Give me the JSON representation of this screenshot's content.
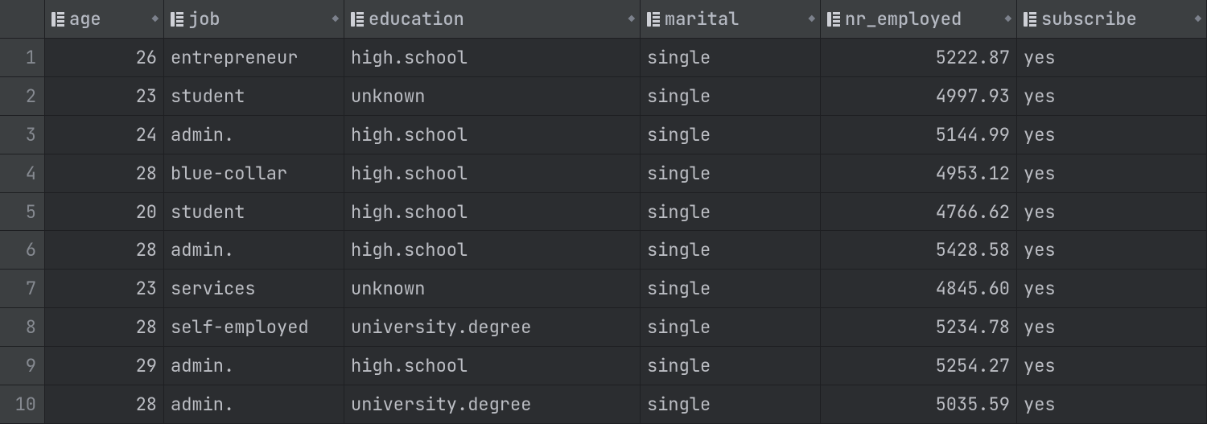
{
  "columns": [
    {
      "name": "age",
      "align": "num"
    },
    {
      "name": "job",
      "align": "txt"
    },
    {
      "name": "education",
      "align": "txt"
    },
    {
      "name": "marital",
      "align": "txt"
    },
    {
      "name": "nr_employed",
      "align": "num"
    },
    {
      "name": "subscribe",
      "align": "txt"
    }
  ],
  "rows": [
    {
      "n": "1",
      "age": "26",
      "job": "entrepreneur",
      "education": "high.school",
      "marital": "single",
      "nr_employed": "5222.87",
      "subscribe": "yes"
    },
    {
      "n": "2",
      "age": "23",
      "job": "student",
      "education": "unknown",
      "marital": "single",
      "nr_employed": "4997.93",
      "subscribe": "yes"
    },
    {
      "n": "3",
      "age": "24",
      "job": "admin.",
      "education": "high.school",
      "marital": "single",
      "nr_employed": "5144.99",
      "subscribe": "yes"
    },
    {
      "n": "4",
      "age": "28",
      "job": "blue-collar",
      "education": "high.school",
      "marital": "single",
      "nr_employed": "4953.12",
      "subscribe": "yes"
    },
    {
      "n": "5",
      "age": "20",
      "job": "student",
      "education": "high.school",
      "marital": "single",
      "nr_employed": "4766.62",
      "subscribe": "yes"
    },
    {
      "n": "6",
      "age": "28",
      "job": "admin.",
      "education": "high.school",
      "marital": "single",
      "nr_employed": "5428.58",
      "subscribe": "yes"
    },
    {
      "n": "7",
      "age": "23",
      "job": "services",
      "education": "unknown",
      "marital": "single",
      "nr_employed": "4845.60",
      "subscribe": "yes"
    },
    {
      "n": "8",
      "age": "28",
      "job": "self-employed",
      "education": "university.degree",
      "marital": "single",
      "nr_employed": "5234.78",
      "subscribe": "yes"
    },
    {
      "n": "9",
      "age": "29",
      "job": "admin.",
      "education": "high.school",
      "marital": "single",
      "nr_employed": "5254.27",
      "subscribe": "yes"
    },
    {
      "n": "10",
      "age": "28",
      "job": "admin.",
      "education": "university.degree",
      "marital": "single",
      "nr_employed": "5035.59",
      "subscribe": "yes"
    }
  ],
  "sort_glyph": "◆"
}
